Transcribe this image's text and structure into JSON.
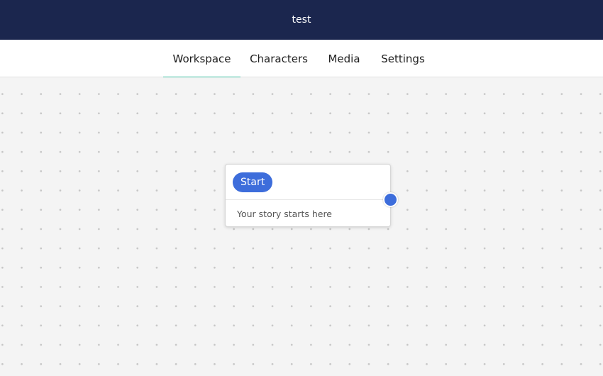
{
  "header": {
    "title": "test"
  },
  "tabs": [
    {
      "label": "Workspace",
      "active": true
    },
    {
      "label": "Characters",
      "active": false
    },
    {
      "label": "Media",
      "active": false
    },
    {
      "label": "Settings",
      "active": false
    }
  ],
  "workspace": {
    "start_node": {
      "badge": "Start",
      "text": "Your story starts here"
    }
  },
  "colors": {
    "header_bg": "#1b264e",
    "tab_underline": "#3dbfa0",
    "accent": "#3d6ddb"
  }
}
